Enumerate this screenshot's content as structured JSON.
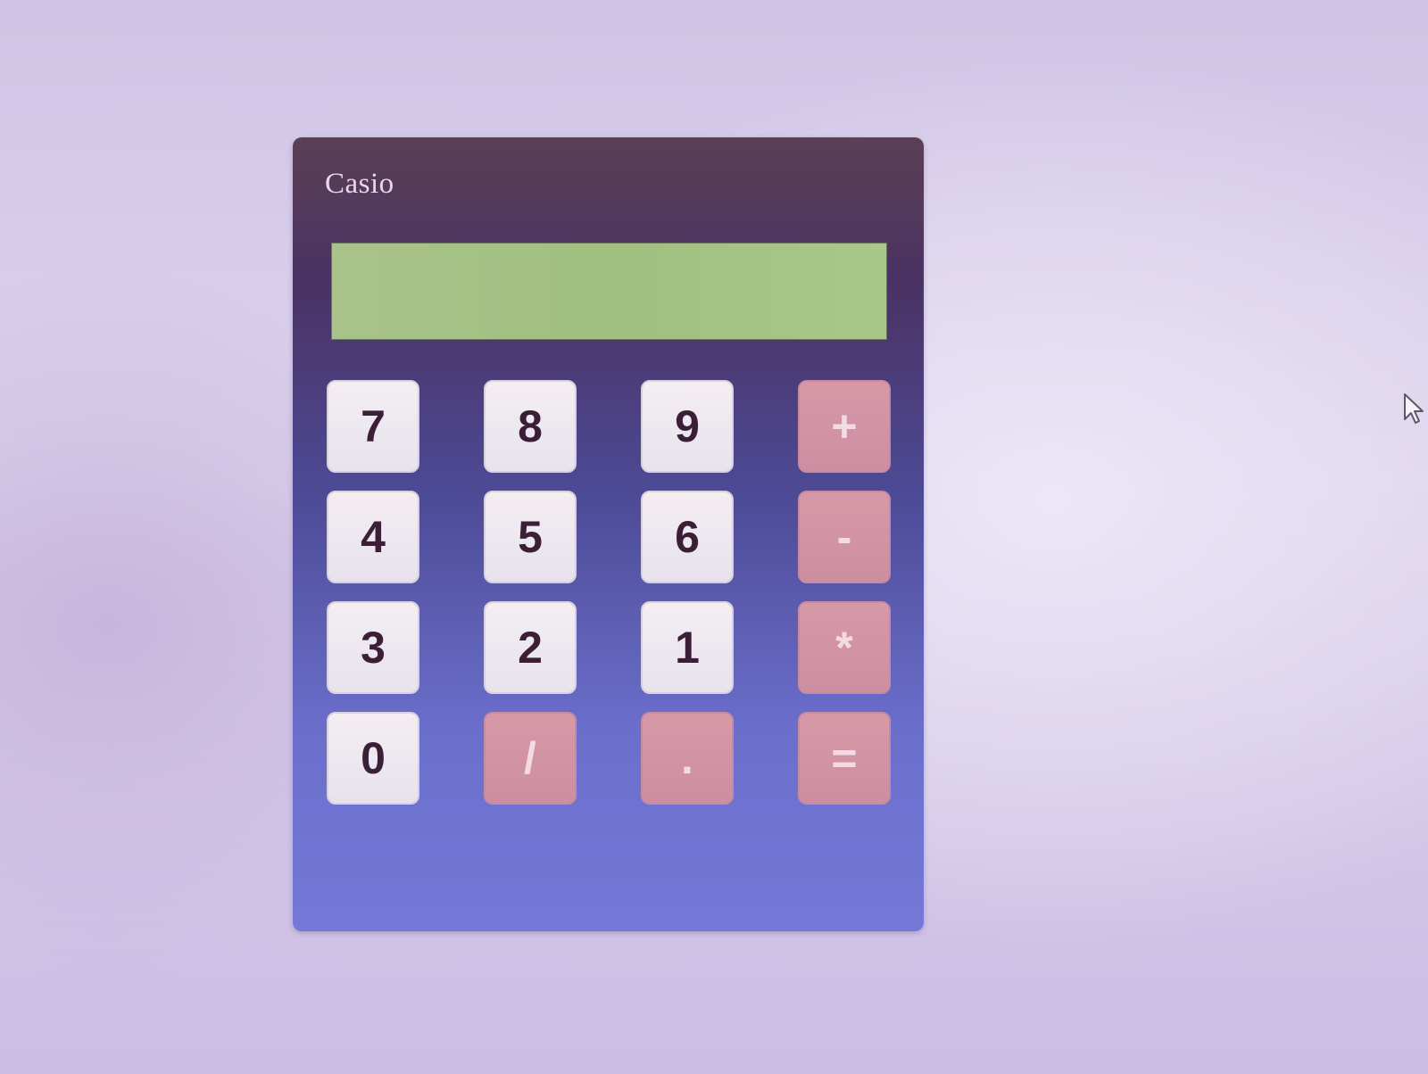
{
  "calculator": {
    "brand": "Casio",
    "display_value": "",
    "keys": [
      {
        "label": "7",
        "kind": "num",
        "name": "key-7"
      },
      {
        "label": "8",
        "kind": "num",
        "name": "key-8"
      },
      {
        "label": "9",
        "kind": "num",
        "name": "key-9"
      },
      {
        "label": "+",
        "kind": "op",
        "name": "key-plus"
      },
      {
        "label": "4",
        "kind": "num",
        "name": "key-4"
      },
      {
        "label": "5",
        "kind": "num",
        "name": "key-5"
      },
      {
        "label": "6",
        "kind": "num",
        "name": "key-6"
      },
      {
        "label": "-",
        "kind": "op",
        "name": "key-minus"
      },
      {
        "label": "3",
        "kind": "num",
        "name": "key-3"
      },
      {
        "label": "2",
        "kind": "num",
        "name": "key-2"
      },
      {
        "label": "1",
        "kind": "num",
        "name": "key-1"
      },
      {
        "label": "*",
        "kind": "op",
        "name": "key-multiply"
      },
      {
        "label": "0",
        "kind": "num",
        "name": "key-0"
      },
      {
        "label": "/",
        "kind": "op",
        "name": "key-divide"
      },
      {
        "label": ".",
        "kind": "op",
        "name": "key-decimal"
      },
      {
        "label": "=",
        "kind": "op",
        "name": "key-equals"
      }
    ]
  },
  "colors": {
    "display_bg": "#a3c283",
    "number_key_bg": "#ece6ef",
    "operator_key_bg": "#d396a5",
    "number_key_text": "#3a1f36",
    "operator_key_text": "#f2dbe4"
  },
  "icons": {
    "cursor": "mouse-pointer-icon"
  }
}
